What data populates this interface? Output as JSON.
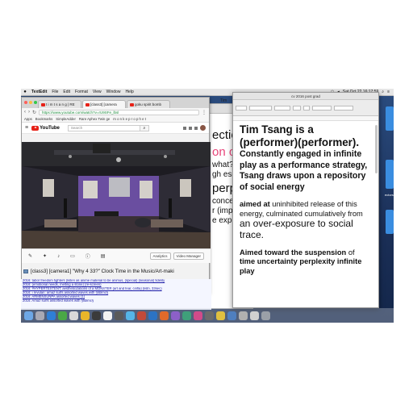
{
  "menubar": {
    "apple": "",
    "app": "TextEdit",
    "items": [
      "File",
      "Edit",
      "Format",
      "View",
      "Window",
      "Help"
    ],
    "clock": "Sat Oct 22  16:17:59",
    "doc_title": "cv 2016 post grad"
  },
  "browser": {
    "tabs": [
      {
        "label": "t i m t s a n g | RE"
      },
      {
        "label": "[class3] [camera"
      },
      {
        "label": "goku spirit bomb"
      }
    ],
    "url": "https://www.youtube.com/watch?v=rU9SFe_lbsl",
    "bookmarks": [
      "Apps",
      "Bookmarks",
      "SimpleAdder",
      "Rare Aphex Twin ge",
      "m o n k e p r o p h e t"
    ],
    "yt_logo": "YouTube",
    "search_placeholder": "Search",
    "controls": {
      "analytics": "Analytics",
      "video_manager": "Video Manager"
    },
    "video_title": "[class3] [camera1] \"Why 4 33?\" Clock Time in the Music/Art-maki"
  },
  "links": [
    "2016: tabor freedom fighters (listen as anime material to be animus, (special) (seasonal) fidelity",
    "2016: (emotional needs, melting a stone) (re-screen)",
    "2016: #HYPERTEXTENT: aestheticizations of a MONSTER (art and fear, cinfla) (listn, 33sec)",
    "2016: i revulan: arnaz surfs assorted waves with §fiblmc§",
    "2016: ARMENSUNPA assorted waves (1)",
    "2016: Arnaz surfs assorted waves with §fiblmc§"
  ],
  "back_doc": {
    "tab": "Tim",
    "lines": [
      "ection",
      "on of ti",
      "what?)",
      "gh escap",
      "perplex",
      "concert",
      "r (implie",
      "e exposu"
    ]
  },
  "doc": {
    "heading": "Tim Tsang is a (performer)(performer).",
    "subheading": "Constantly engaged in infinite play as a performance strategy, Tsang draws upon a repository of social energy",
    "p1_bold": "aimed at",
    "p1_a": " uninhibited release of this energy, culminated cumulatively from ",
    "p1_big": "an over-exposure to social trace.",
    "p2_bold": "Aimed toward the suspension",
    "p2_normal": " of",
    "p2_rest": "time uncertainty perplexity infinite play"
  },
  "right_label": "ectors",
  "colors": {
    "youtube_red": "#e62117",
    "desktop": "#1f3a66",
    "link": "#1a1aa6"
  }
}
